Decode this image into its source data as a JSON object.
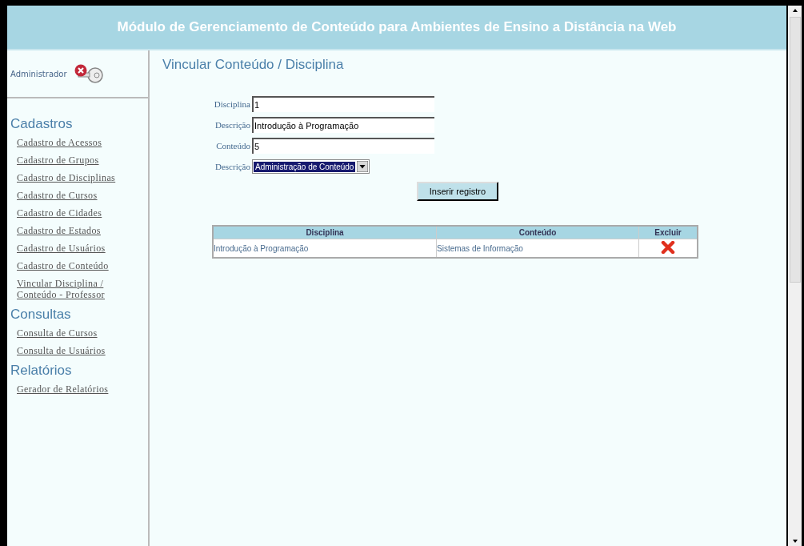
{
  "header": {
    "title": "Módulo de Gerenciamento de Conteúdo para Ambientes de Ensino a Distância na Web"
  },
  "user": {
    "name": "Administrador"
  },
  "sidebar": {
    "sections": [
      {
        "title": "Cadastros",
        "items": [
          "Cadastro de Acessos",
          "Cadastro de Grupos",
          "Cadastro de Disciplinas",
          "Cadastro de Cursos",
          "Cadastro de Cidades",
          "Cadastro de Estados",
          "Cadastro de Usuários",
          "Cadastro de Conteúdo",
          "Vincular Disciplina / Conteúdo - Professor"
        ]
      },
      {
        "title": "Consultas",
        "items": [
          "Consulta de Cursos",
          "Consulta de Usuários"
        ]
      },
      {
        "title": "Relatórios",
        "items": [
          "Gerador de Relatórios"
        ]
      }
    ]
  },
  "page": {
    "title": "Vincular Conteúdo / Disciplina"
  },
  "form": {
    "fields": [
      {
        "label": "Disciplina",
        "kind": "text",
        "value": "1"
      },
      {
        "label": "Descrição",
        "kind": "text",
        "value": "Introdução à Programação"
      },
      {
        "label": "Conteúdo",
        "kind": "text",
        "value": "5"
      },
      {
        "label": "Descrição",
        "kind": "select",
        "value": "Administração de Conteúdo"
      }
    ],
    "submit": "Inserir registro"
  },
  "table": {
    "columns": [
      "Disciplina",
      "Conteúdo",
      "Excluir"
    ],
    "rows": [
      {
        "disciplina": "Introdução à Programação",
        "conteudo": "Sistemas de Informação"
      }
    ]
  }
}
